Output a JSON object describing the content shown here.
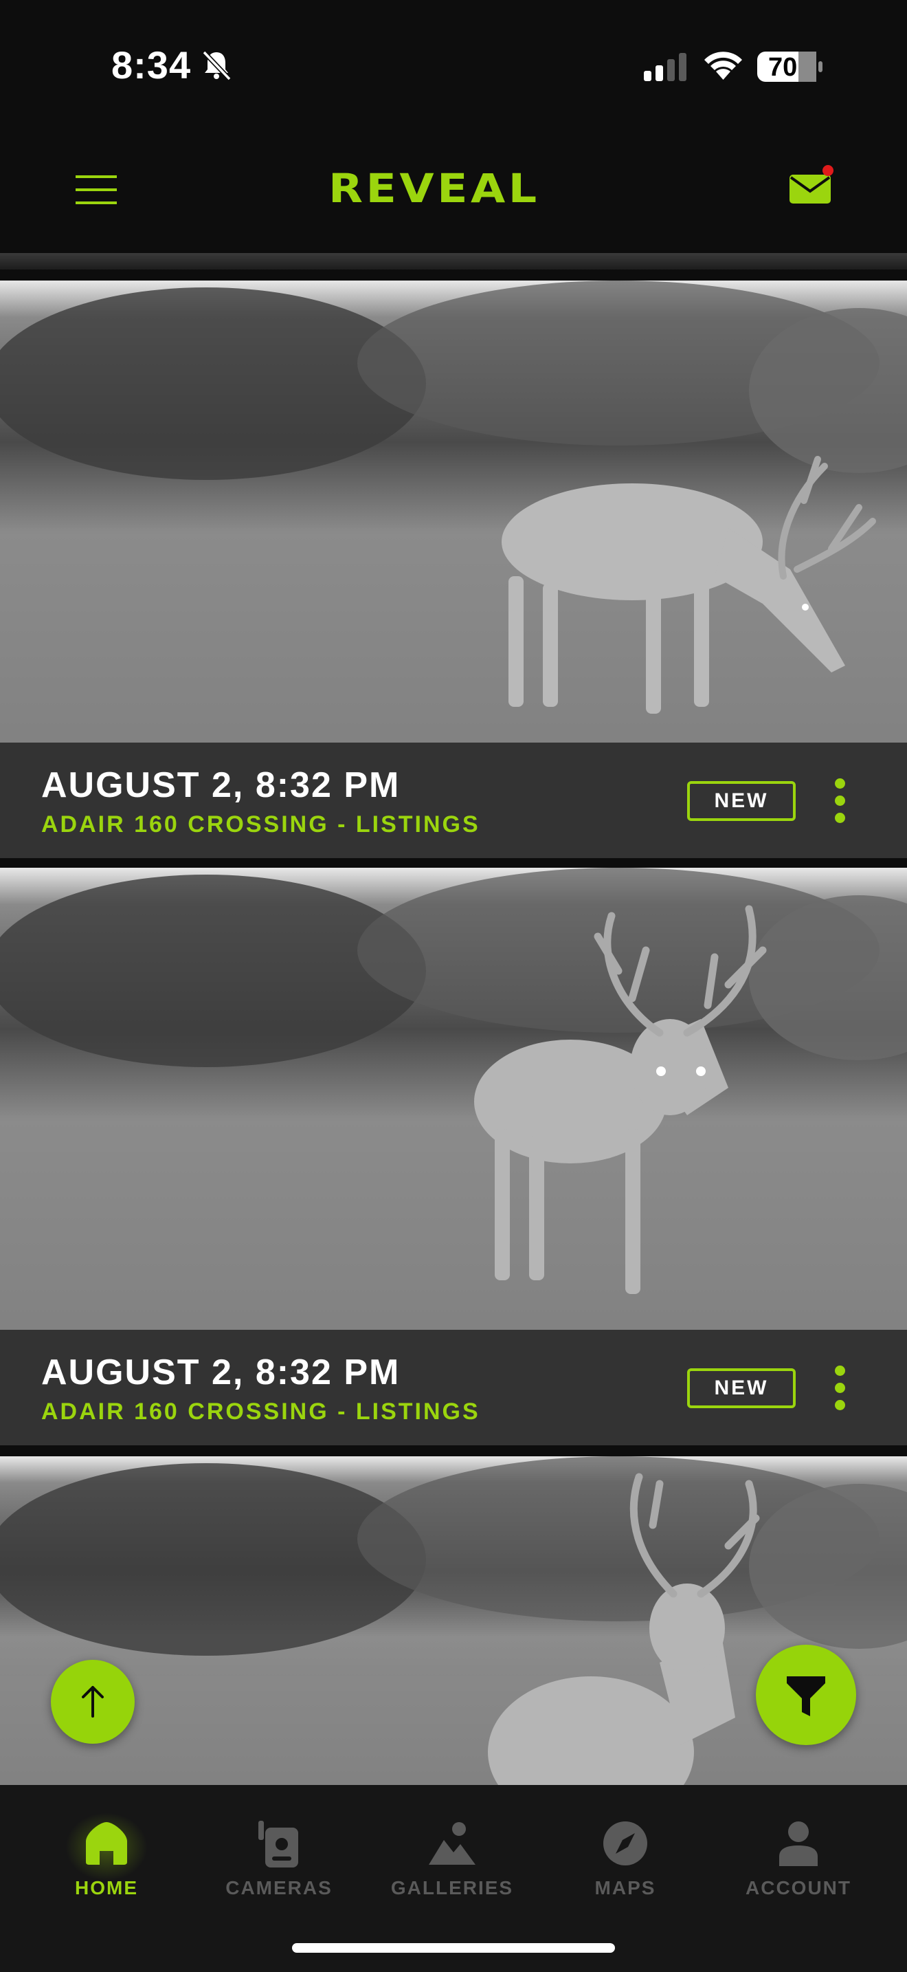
{
  "status_bar": {
    "time": "8:34",
    "battery": "70"
  },
  "header": {
    "logo": "REVEAL",
    "has_unread_mail": true
  },
  "photos": [
    {
      "date": "AUGUST 2, 8:32 PM",
      "camera": "ADAIR 160 CROSSING - LISTINGS",
      "badge": "NEW"
    },
    {
      "date": "AUGUST 2, 8:32 PM",
      "camera": "ADAIR 160 CROSSING - LISTINGS",
      "badge": "NEW"
    }
  ],
  "bottom_nav": {
    "items": [
      {
        "label": "HOME",
        "icon": "home-icon",
        "active": true
      },
      {
        "label": "CAMERAS",
        "icon": "camera-icon",
        "active": false
      },
      {
        "label": "GALLERIES",
        "icon": "galleries-icon",
        "active": false
      },
      {
        "label": "MAPS",
        "icon": "compass-icon",
        "active": false
      },
      {
        "label": "ACCOUNT",
        "icon": "account-icon",
        "active": false
      }
    ]
  },
  "colors": {
    "accent": "#9bd50e",
    "background": "#0d0d0d",
    "caption_bg": "#333333"
  }
}
